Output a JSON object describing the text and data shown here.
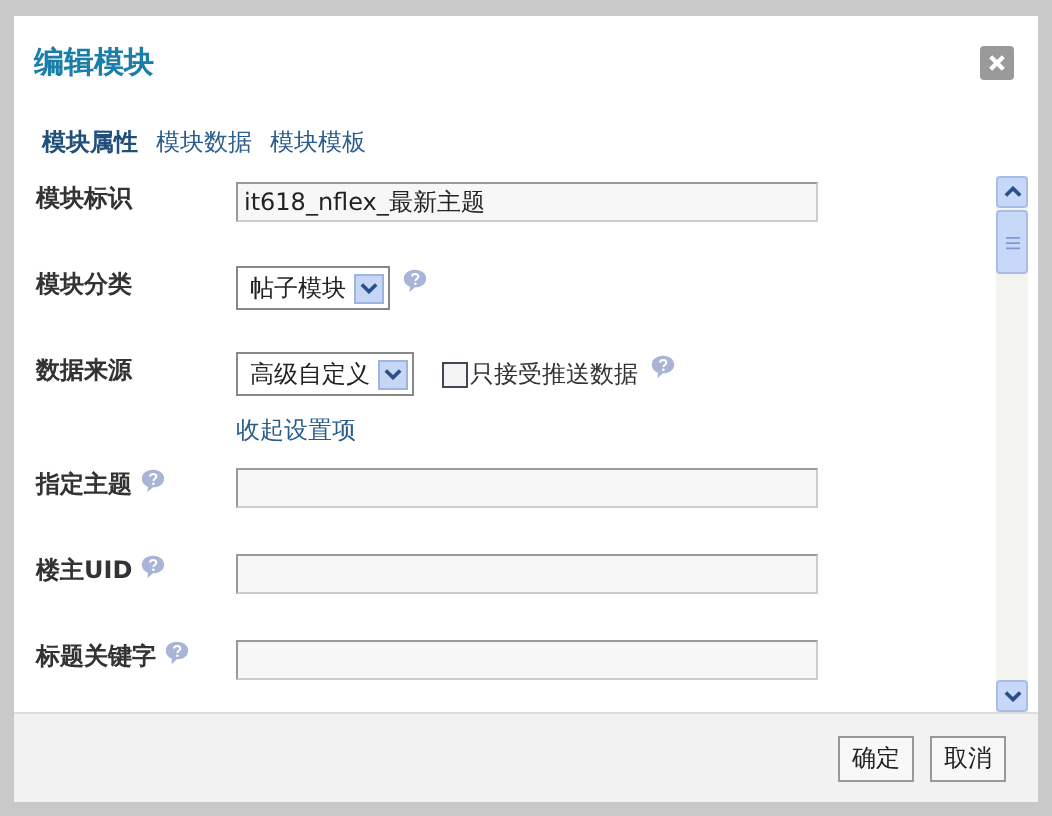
{
  "dialog": {
    "title": "编辑模块"
  },
  "tabs": [
    {
      "label": "模块属性",
      "selected": true
    },
    {
      "label": "模块数据",
      "selected": false
    },
    {
      "label": "模块模板",
      "selected": false
    }
  ],
  "form": [
    {
      "kind": "text",
      "label": "模块标识",
      "value": "it618_nflex_最新主题",
      "help": false
    },
    {
      "kind": "select",
      "label": "模块分类",
      "value": "帖子模块",
      "help": true
    },
    {
      "kind": "select",
      "label": "数据来源",
      "value": "高级自定义",
      "help": false,
      "checkbox": {
        "label": "只接受推送数据",
        "checked": false,
        "help": true
      }
    },
    {
      "kind": "link",
      "label": "收起设置项"
    },
    {
      "kind": "text",
      "label": "指定主题",
      "help": true
    },
    {
      "kind": "text",
      "label": "楼主UID",
      "help": true
    },
    {
      "kind": "text",
      "label": "标题关键字",
      "help": true
    }
  ],
  "buttons": [
    {
      "label": "确定"
    },
    {
      "label": "取消"
    }
  ]
}
